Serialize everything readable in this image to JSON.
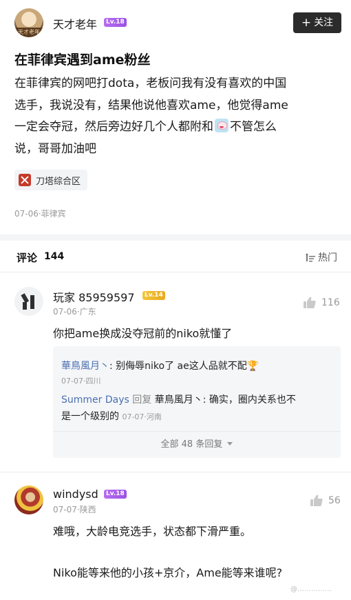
{
  "post": {
    "author": "天才老年",
    "author_level": "Lv.18",
    "avatar_caption": "天才老年",
    "follow_label": "关注",
    "title": "在菲律宾遇到ame粉丝",
    "body_lines": [
      "在菲律宾的网吧打dota，老板问我有没有喜欢的中国",
      "选手，我说没有，结果他说他喜欢ame，他觉得ame",
      "一定会夺冠，然后旁边好几个人都附和",
      "不管怎么",
      "说，哥哥加油吧"
    ],
    "tag": "刀塔综合区",
    "meta": "07-06·菲律宾"
  },
  "comments_header": {
    "title": "评论",
    "count": "144",
    "sort_label": "热门"
  },
  "comments": [
    {
      "name": "玩家 85959597",
      "level": "Lv.14",
      "meta": "07-06·广东",
      "likes": "116",
      "text": "你把ame换成没夺冠前的niko就懂了",
      "replies": [
        {
          "author": "華鳥風月丶",
          "text": ": 别侮辱niko了 ae这人品就不配🏆",
          "meta": "07-07·四川"
        },
        {
          "author": "Summer Days",
          "reply_word": "回复",
          "reply_to": "華鳥風月丶",
          "text_line1": ": 确实，圈内关系也不",
          "text_line2": "是一个级别的",
          "meta": "07-07·河南"
        }
      ],
      "all_replies": "全部 48 条回复"
    },
    {
      "name": "windysd",
      "level": "Lv.18",
      "meta": "07-07·陕西",
      "likes": "56",
      "text_line1": "难哦，大龄电竞选手，状态都下滑严重。",
      "text_line2": "Niko能等来他的小孩+京介，Ame能等来谁呢?"
    }
  ],
  "watermark": "@……………"
}
